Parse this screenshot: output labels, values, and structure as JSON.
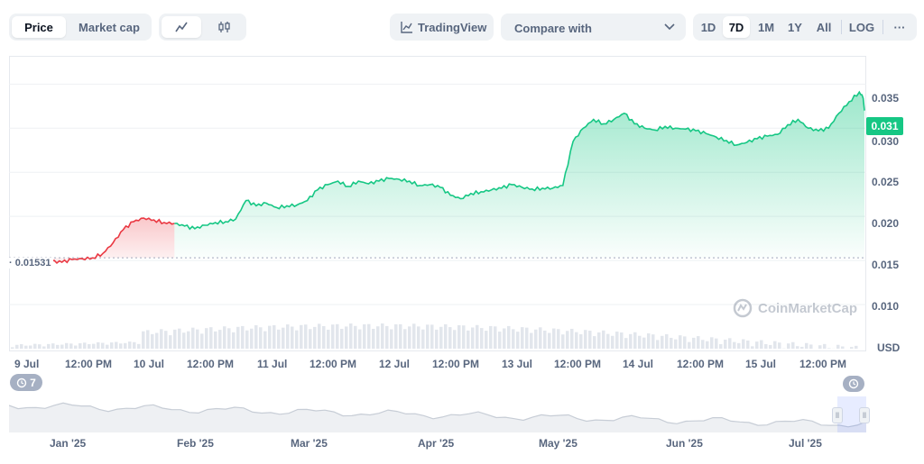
{
  "toolbar": {
    "price_label": "Price",
    "market_cap_label": "Market cap",
    "line_icon": "line-chart-icon",
    "candle_icon": "candlestick-icon",
    "tradingview_label": "TradingView",
    "compare_label": "Compare with",
    "ranges": [
      "1D",
      "7D",
      "1M",
      "1Y",
      "All"
    ],
    "active_range": "7D",
    "log_label": "LOG",
    "more_label": "···"
  },
  "badges": {
    "current_price": "0.031",
    "open_price": "0.01531",
    "history_count": "7"
  },
  "watermark": "CoinMarketCap",
  "colors": {
    "up": "#16c784",
    "down": "#ea3943",
    "badge_bg": "#16c784",
    "navigator_line": "#c7cdd6"
  },
  "navigator": {
    "labels": [
      "Jan '25",
      "Feb '25",
      "Mar '25",
      "Apr '25",
      "May '25",
      "Jun '25",
      "Jul '25"
    ]
  },
  "chart_data": {
    "type": "area",
    "currency": "USD",
    "ylim": [
      0.005,
      0.038
    ],
    "y_ticks": [
      "0.035",
      "0.030",
      "0.025",
      "0.020",
      "0.015",
      "0.010"
    ],
    "y_unit_label": "USD",
    "x_ticks": [
      "9 Jul",
      "12:00 PM",
      "10 Jul",
      "12:00 PM",
      "11 Jul",
      "12:00 PM",
      "12 Jul",
      "12:00 PM",
      "13 Jul",
      "12:00 PM",
      "14 Jul",
      "12:00 PM",
      "15 Jul",
      "12:00 PM"
    ],
    "baseline": 0.01531,
    "x_hours": [
      0,
      2,
      4,
      6,
      8,
      10,
      12,
      14,
      16,
      18,
      20,
      22,
      24,
      26,
      28,
      30,
      32,
      34,
      36,
      38,
      40,
      42,
      44,
      46,
      48,
      50,
      52,
      54,
      56,
      58,
      60,
      62,
      64,
      66,
      68,
      70,
      72,
      74,
      76,
      78,
      80,
      82,
      84,
      86,
      88,
      90,
      92,
      94,
      96,
      98,
      100,
      102,
      104,
      106,
      108,
      110,
      112,
      114,
      116,
      118,
      120,
      122,
      124,
      126,
      128,
      130,
      132,
      134,
      136,
      138,
      140,
      142,
      144,
      146,
      148,
      150,
      152,
      154,
      156,
      158,
      160,
      162,
      164,
      166,
      167
    ],
    "values": [
      0.015,
      0.0149,
      0.015,
      0.0151,
      0.0149,
      0.0148,
      0.0151,
      0.0152,
      0.0153,
      0.0158,
      0.017,
      0.0185,
      0.0194,
      0.0198,
      0.0196,
      0.0193,
      0.0192,
      0.0189,
      0.0186,
      0.019,
      0.0193,
      0.0194,
      0.0197,
      0.0218,
      0.0212,
      0.0215,
      0.021,
      0.0212,
      0.0213,
      0.0218,
      0.023,
      0.0236,
      0.024,
      0.0234,
      0.024,
      0.0237,
      0.024,
      0.0243,
      0.0242,
      0.024,
      0.0235,
      0.0236,
      0.0233,
      0.0224,
      0.022,
      0.0226,
      0.0228,
      0.023,
      0.0232,
      0.0236,
      0.0233,
      0.0231,
      0.0232,
      0.0232,
      0.0235,
      0.0285,
      0.03,
      0.031,
      0.0305,
      0.031,
      0.0317,
      0.0305,
      0.03,
      0.0298,
      0.0302,
      0.03,
      0.0299,
      0.0297,
      0.0294,
      0.029,
      0.0286,
      0.0281,
      0.0284,
      0.0288,
      0.0291,
      0.0293,
      0.0304,
      0.031,
      0.03,
      0.0297,
      0.03,
      0.0317,
      0.033,
      0.0341,
      0.0333,
      0.034,
      0.0329,
      0.032
    ]
  }
}
